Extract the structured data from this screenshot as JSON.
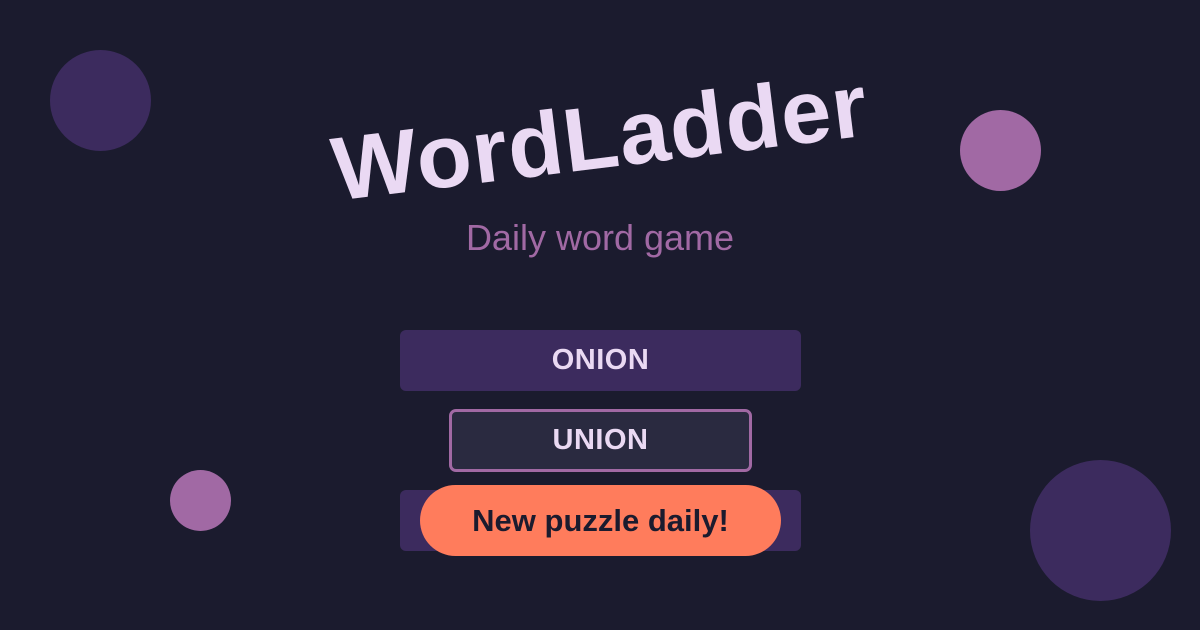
{
  "header": {
    "title": "WordLadder",
    "subtitle": "Daily word game"
  },
  "ladder": {
    "words": [
      "ONION",
      "UNION",
      ""
    ]
  },
  "cta": {
    "label": "New puzzle daily!"
  },
  "colors": {
    "background": "#1b1b2e",
    "title_text": "#ead9f3",
    "accent_purple": "#a169a4",
    "dark_purple": "#3c2b5e",
    "active_rung": "#2a2a40",
    "cta_background": "#ff7c5c",
    "cta_text": "#1b1b2e"
  }
}
